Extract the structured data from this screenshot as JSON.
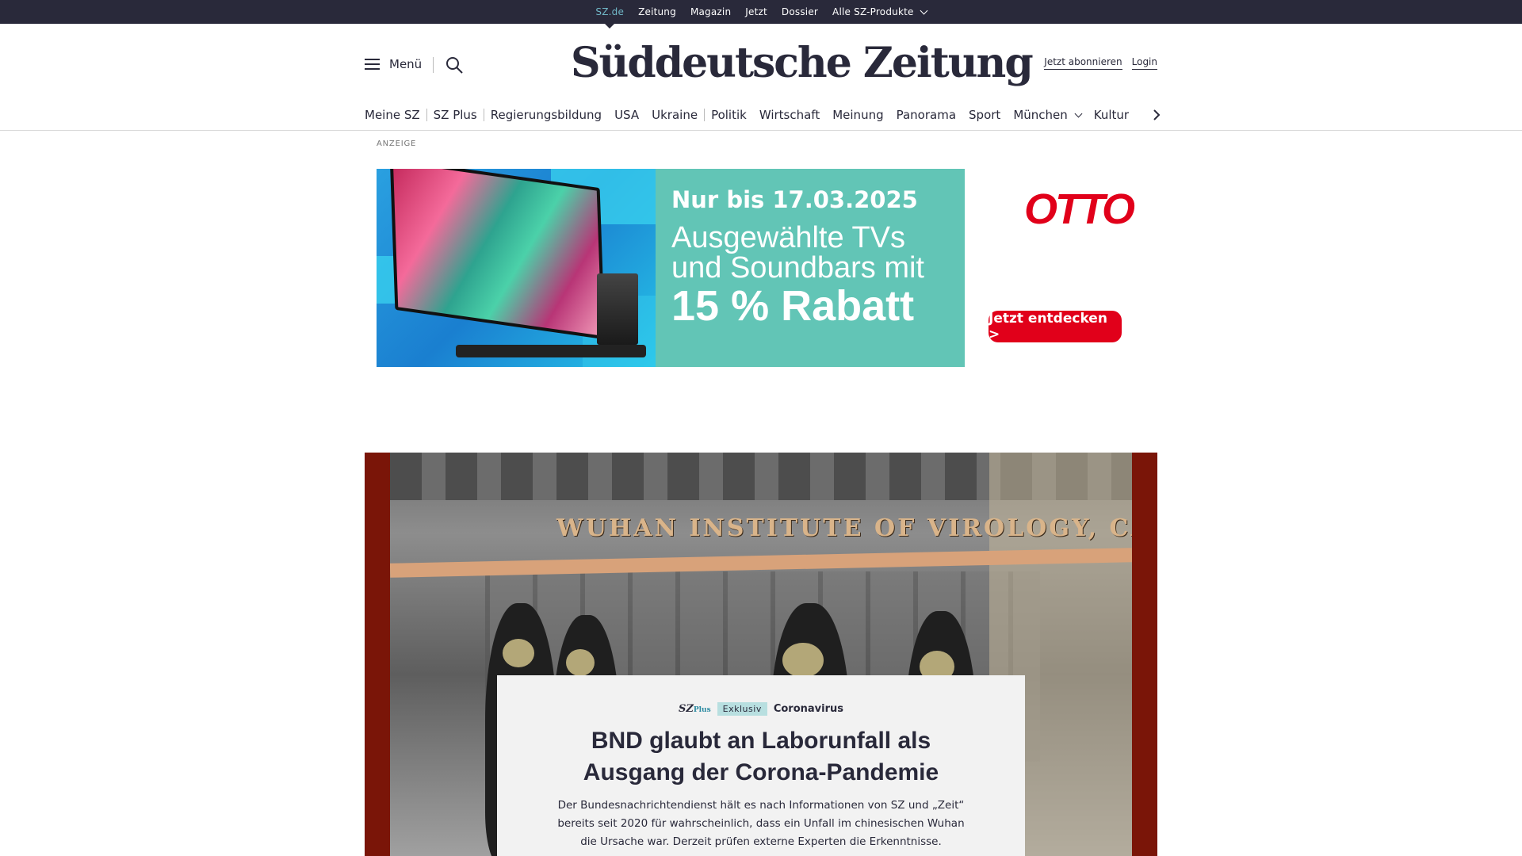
{
  "topbar": {
    "items": [
      "SZ.de",
      "Zeitung",
      "Magazin",
      "Jetzt",
      "Dossier",
      "Alle SZ-Produkte"
    ]
  },
  "header": {
    "menu_label": "Menü",
    "logo": "Süddeutsche Zeitung",
    "subscribe": "Jetzt abonnieren",
    "login": "Login"
  },
  "nav": {
    "items": [
      "Meine SZ",
      "SZ Plus",
      "Regierungsbildung",
      "USA",
      "Ukraine",
      "Politik",
      "Wirtschaft",
      "Meinung",
      "Panorama",
      "Sport",
      "München",
      "Kultur"
    ]
  },
  "ad": {
    "label": "ANZEIGE",
    "date": "Nur bis 17.03.2025",
    "line1": "Ausgewählte TVs",
    "line2": "und Soundbars mit",
    "big": "15 % Rabatt",
    "brand": "OTTO",
    "cta": "Jetzt entdecken >"
  },
  "hero": {
    "sign_text": "WUHAN INSTITUTE OF VIROLOGY, CAS",
    "brand": "SZ",
    "brand_suffix": "Plus",
    "badge": "Exklusiv",
    "topic": "Coronavirus",
    "headline": "BND glaubt an Laborunfall als Ausgang der Corona-Pandemie",
    "lead": "Der Bundesnachrichtendienst hält es nach Informationen von SZ und „Zeit“ bereits seit 2020 für wahrscheinlich, dass ein Unfall im chinesischen Wuhan die Ursache war. Derzeit prüfen externe Experten die Erkenntnisse."
  },
  "colors": {
    "topbar": "#29293a",
    "accent": "#71b8c8",
    "ad_teal": "#62c5b6",
    "otto_red": "#e1001a",
    "hero_frame": "#7a1508"
  }
}
